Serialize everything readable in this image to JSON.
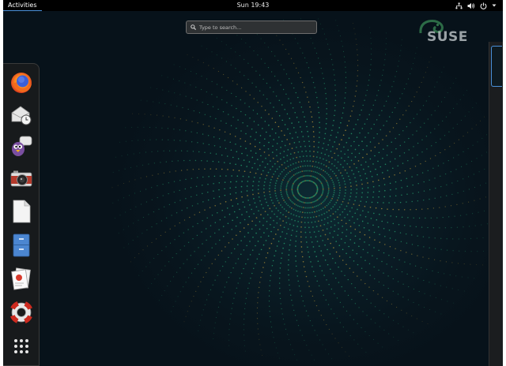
{
  "topbar": {
    "activities_label": "Activities",
    "clock": "Sun 19:43",
    "tray_icons": [
      "network-icon",
      "volume-icon",
      "power-icon",
      "chevron-down-icon"
    ]
  },
  "search": {
    "placeholder": "Type to search..."
  },
  "brand": {
    "logo_text": "SUSE",
    "logo_color": "#bfc6c9"
  },
  "dash": {
    "items": [
      {
        "name": "firefox-icon"
      },
      {
        "name": "evolution-mail-icon"
      },
      {
        "name": "pidgin-icon"
      },
      {
        "name": "camera-icon"
      },
      {
        "name": "text-editor-icon"
      },
      {
        "name": "files-icon"
      },
      {
        "name": "document-viewer-icon"
      },
      {
        "name": "help-icon"
      },
      {
        "name": "show-applications-icon"
      }
    ]
  },
  "colors": {
    "accent": "#4a90d9",
    "topbar": "#000000",
    "background": "#08151d",
    "swirl_green": "#2bb57a",
    "swirl_yellow": "#c6a13a"
  }
}
